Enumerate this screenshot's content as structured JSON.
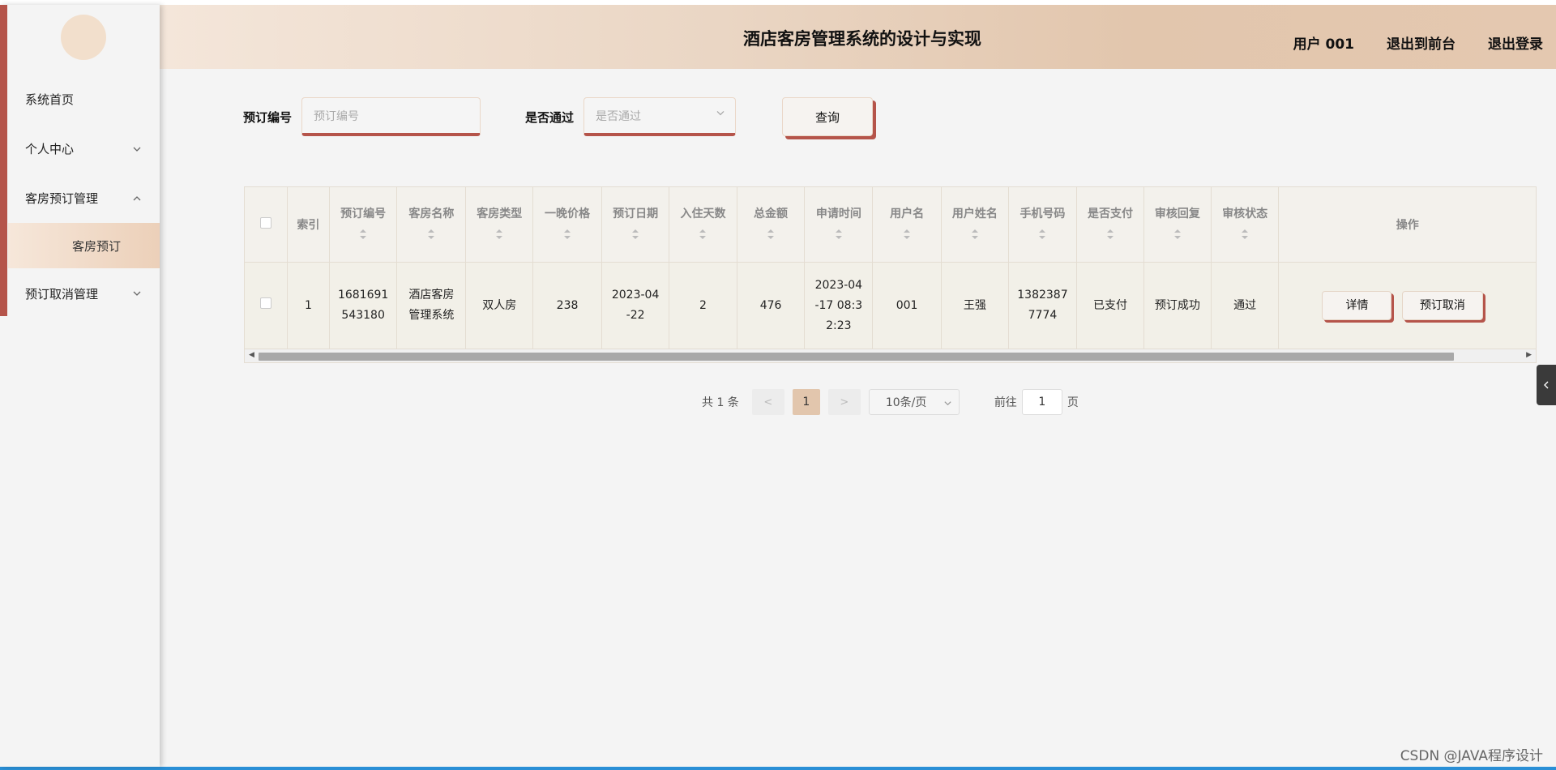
{
  "header": {
    "title": "酒店客房管理系统的设计与实现",
    "user": "用户 001",
    "exit_front": "退出到前台",
    "logout": "退出登录"
  },
  "sidebar": {
    "items": [
      {
        "label": "系统首页"
      },
      {
        "label": "个人中心"
      },
      {
        "label": "客房预订管理"
      },
      {
        "label": "客房预订"
      },
      {
        "label": "预订取消管理"
      }
    ]
  },
  "search": {
    "order_label": "预订编号",
    "order_placeholder": "预订编号",
    "pass_label": "是否通过",
    "pass_placeholder": "是否通过",
    "query_button": "查询"
  },
  "table": {
    "headers": [
      "索引",
      "预订编号",
      "客房名称",
      "客房类型",
      "一晚价格",
      "预订日期",
      "入住天数",
      "总金额",
      "申请时间",
      "用户名",
      "用户姓名",
      "手机号码",
      "是否支付",
      "审核回复",
      "审核状态",
      "操作"
    ],
    "rows": [
      {
        "index": "1",
        "order_no": "1681691543180",
        "room_name": "酒店客房管理系统",
        "room_type": "双人房",
        "price": "238",
        "date": "2023-04-22",
        "days": "2",
        "total": "476",
        "apply_time": "2023-04-17 08:32:23",
        "username": "001",
        "name": "王强",
        "phone": "13823877774",
        "paid": "已支付",
        "reply": "预订成功",
        "status": "通过",
        "btn_detail": "详情",
        "btn_cancel": "预订取消"
      }
    ]
  },
  "pager": {
    "total": "共 1 条",
    "prev": "<",
    "current": "1",
    "next": ">",
    "page_size": "10条/页",
    "goto_label": "前往",
    "goto_value": "1",
    "page_unit": "页"
  },
  "watermark": "CSDN @JAVA程序设计",
  "colors": {
    "accent": "#b5544a",
    "header_gradient_start": "#f4e6da",
    "header_gradient_end": "#e2c6ad",
    "active_page": "#e2c6ad"
  }
}
